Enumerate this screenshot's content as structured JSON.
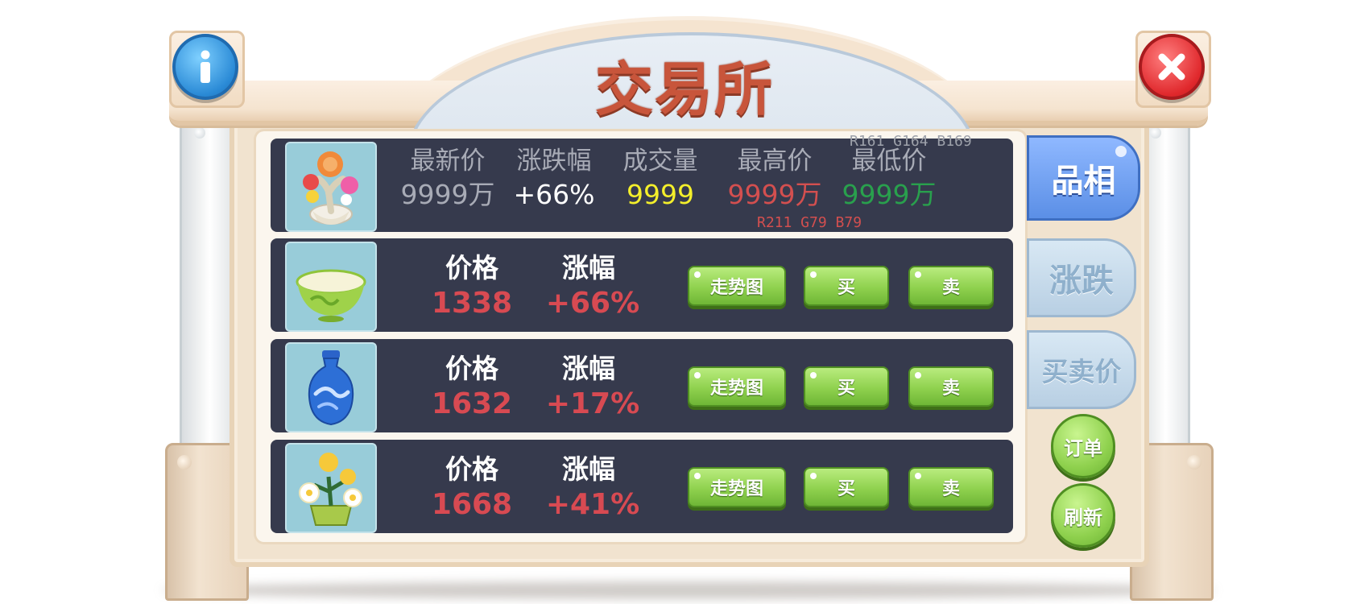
{
  "title": "交易所",
  "header": {
    "labels": [
      "最新价",
      "涨跌幅",
      "成交量",
      "最高价",
      "最低价"
    ],
    "values": [
      "9999万",
      "+66%",
      "9999",
      "9999万",
      "9999万"
    ],
    "value_colors": [
      "#a8abb6",
      "#ffffff",
      "#f4ef2b",
      "#d34f4f",
      "#29a04d"
    ]
  },
  "annotations": {
    "top": "R161 G164 B169",
    "bottom": "R211 G79 B79"
  },
  "items": [
    {
      "icon": "tea-bowl-icon",
      "price_label": "价格",
      "change_label": "涨幅",
      "price": "1338",
      "change": "+66%"
    },
    {
      "icon": "blue-vase-icon",
      "price_label": "价格",
      "change_label": "涨幅",
      "price": "1632",
      "change": "+17%"
    },
    {
      "icon": "flower-pot-icon",
      "price_label": "价格",
      "change_label": "涨幅",
      "price": "1668",
      "change": "+41%"
    }
  ],
  "buttons": {
    "trend": "走势图",
    "buy": "买",
    "sell": "卖"
  },
  "tabs": [
    "品相",
    "涨跌",
    "买卖价"
  ],
  "side_buttons": {
    "order": "订单",
    "refresh": "刷新"
  },
  "colors": {
    "price_red": "#d84a52",
    "tab_active": "#5b8fe6",
    "button_green": "#8fd14e"
  }
}
